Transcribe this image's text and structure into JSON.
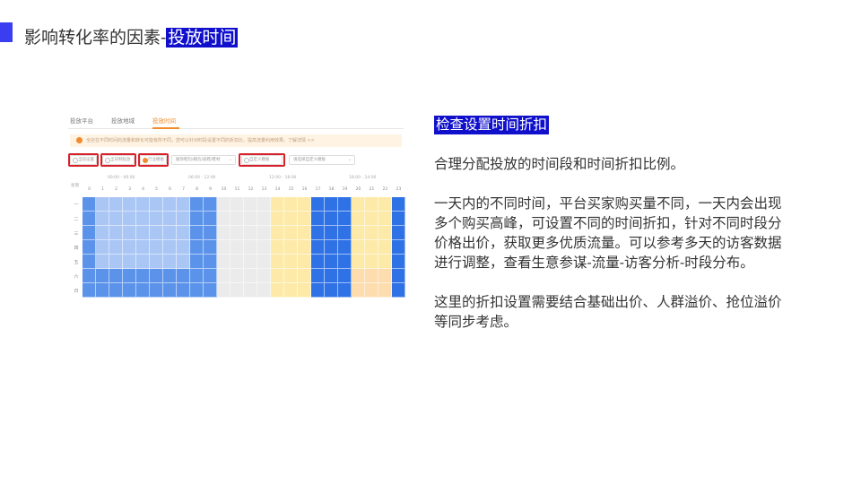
{
  "slide": {
    "title_prefix": "影响转化率的因素-",
    "title_highlight": "投放时间"
  },
  "panel": {
    "tabs": [
      {
        "label": "投放平台",
        "active": false
      },
      {
        "label": "投放地域",
        "active": false
      },
      {
        "label": "投放时间",
        "active": true
      }
    ],
    "notice": "全店在不同时间的流量和转化可能有所不同，您可以针对时段设置不同的折扣比，提高流量利用效果。了解详情 >>",
    "options": [
      {
        "label": "当前设置",
        "selected": false,
        "boxed": true
      },
      {
        "label": "全日制投放",
        "selected": false,
        "boxed": true
      },
      {
        "label": "行业模板",
        "selected": true,
        "boxed": true
      },
      {
        "label": "自定义模板",
        "selected": false,
        "boxed": true
      }
    ],
    "selects": [
      {
        "label": "服饰鞋包/箱包/皮鞋/鞋材"
      },
      {
        "label": "请选择自定义模板"
      }
    ],
    "range_labels": [
      "00:00 - 06:00",
      "06:00 - 12:00",
      "12:00 - 18:00",
      "18:00 - 24:00"
    ],
    "row_header": "星期",
    "hours": [
      "0",
      "1",
      "2",
      "3",
      "4",
      "5",
      "6",
      "7",
      "8",
      "9",
      "10",
      "11",
      "12",
      "13",
      "14",
      "15",
      "16",
      "17",
      "18",
      "19",
      "20",
      "21",
      "22",
      "23"
    ],
    "days": [
      "一",
      "二",
      "三",
      "四",
      "五",
      "六",
      "日"
    ],
    "colors": {
      "light_blue": "#a9c6f5",
      "mid_blue": "#5b93ea",
      "dark_blue": "#2f72e6",
      "grey": "#ebebeb",
      "yellow": "#fdeaa8",
      "peach": "#fddcae",
      "accent": "#f08c2c",
      "highlight": "#d9202a"
    }
  },
  "right": {
    "heading": "检查设置时间折扣",
    "paragraphs": [
      "合理分配投放的时间段和时间折扣比例。",
      "一天内的不同时间，平台买家购买量不同，一天内会出现多个购买高峰，可设置不同的时间折扣，针对不同时段分价格出价，获取更多优质流量。可以参考多天的访客数据进行调整，查看生意参谋-流量-访客分析-时段分布。",
      "这里的折扣设置需要结合基础出价、人群溢价、抢位溢价等同步考虑。"
    ]
  }
}
